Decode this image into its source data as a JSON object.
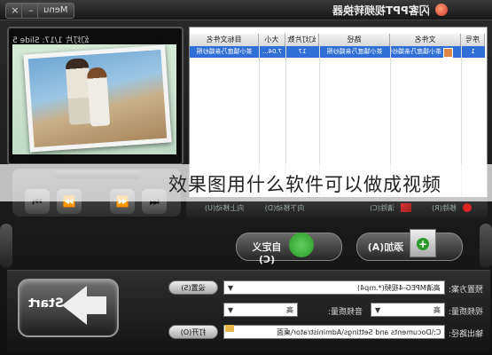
{
  "window": {
    "title": "闪客PPT视频转换器",
    "menu_label": "Menu",
    "minimize_label": "–",
    "close_label": "×"
  },
  "preview": {
    "slide_info": "幻灯片 1/17: Slide 5"
  },
  "player": {
    "buttons": [
      "⏮",
      "⏪",
      "⏩",
      "⏭"
    ]
  },
  "file_list": {
    "columns": [
      "序号",
      "文件名",
      "路径",
      "幻灯片数",
      "大小",
      "目标文件名"
    ],
    "rows": [
      {
        "index": "1",
        "filename": "茶小镇度乃亲婚纱照",
        "path": "茶小镇度乃亲婚纱照",
        "slides": "17",
        "size": "7.04...",
        "target": "茶小镇度乃亲婚纱照"
      }
    ]
  },
  "actions": {
    "remove": "移除(R)",
    "clear": "清除(C)",
    "move_up": "向上移动(U)",
    "move_down": "向下移动(D)"
  },
  "buttons": {
    "add": "添加(A)",
    "customize": "自定义(C)",
    "start": "Start"
  },
  "settings": {
    "preset_label": "预置方案:",
    "preset_value": "高清MPEG-4视频(*.mp4)",
    "video_quality_label": "视频质量:",
    "video_quality_value": "高",
    "audio_quality_label": "音频质量:",
    "audio_quality_value": "高",
    "output_path_label": "输出路径:",
    "output_path_value": "C:\\Documents and Settings\\Administrator\\桌面",
    "settings_button": "设置(S)",
    "open_button": "打开(O)"
  },
  "overlay": {
    "caption": "效果图用什么软件可以做成视频"
  },
  "colors": {
    "selection": "#2f6fd6",
    "frame": "#1a1a1a"
  }
}
